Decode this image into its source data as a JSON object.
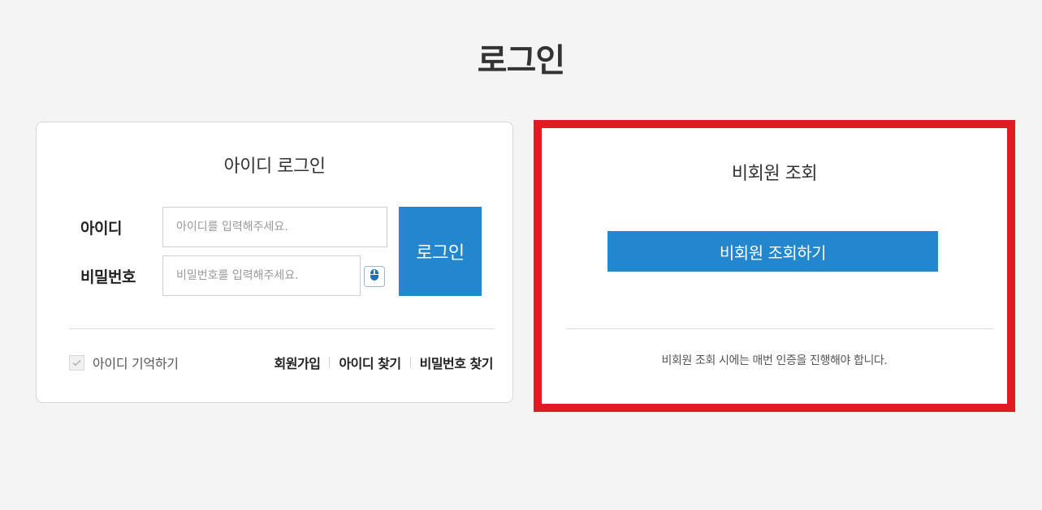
{
  "page": {
    "title": "로그인"
  },
  "member_login": {
    "title": "아이디 로그인",
    "id_label": "아이디",
    "id_placeholder": "아이디를 입력해주세요.",
    "id_value": "",
    "pw_label": "비밀번호",
    "pw_placeholder": "비밀번호를 입력해주세요.",
    "pw_value": "",
    "keyboard_icon": "mouse-keyboard-icon",
    "login_button": "로그인",
    "remember_label": "아이디 기억하기",
    "remember_checked": false,
    "links": {
      "signup": "회원가입",
      "find_id": "아이디 찾기",
      "find_pw": "비밀번호 찾기"
    }
  },
  "guest_lookup": {
    "title": "비회원 조회",
    "button": "비회원 조회하기",
    "note": "비회원 조회 시에는 매번 인증을 진행해야 합니다."
  },
  "colors": {
    "accent": "#2387cd",
    "highlight": "#e11b22",
    "background": "#f4f4f4"
  }
}
